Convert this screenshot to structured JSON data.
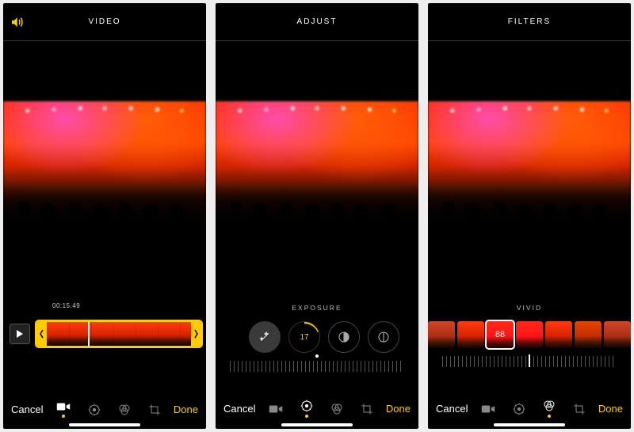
{
  "accent": "#ffcc00",
  "panels": {
    "video": {
      "title": "VIDEO",
      "timecode": "00:15.49",
      "cancel": "Cancel",
      "done": "Done"
    },
    "adjust": {
      "title": "ADJUST",
      "sublabel": "EXPOSURE",
      "exposure_value": "17",
      "cancel": "Cancel",
      "done": "Done"
    },
    "filters": {
      "title": "FILTERS",
      "sublabel": "VIVID",
      "filter_value": "88",
      "cancel": "Cancel",
      "done": "Done"
    }
  },
  "toolbar_icons": [
    "video-icon",
    "adjust-dial-icon",
    "filters-icon",
    "crop-icon"
  ]
}
